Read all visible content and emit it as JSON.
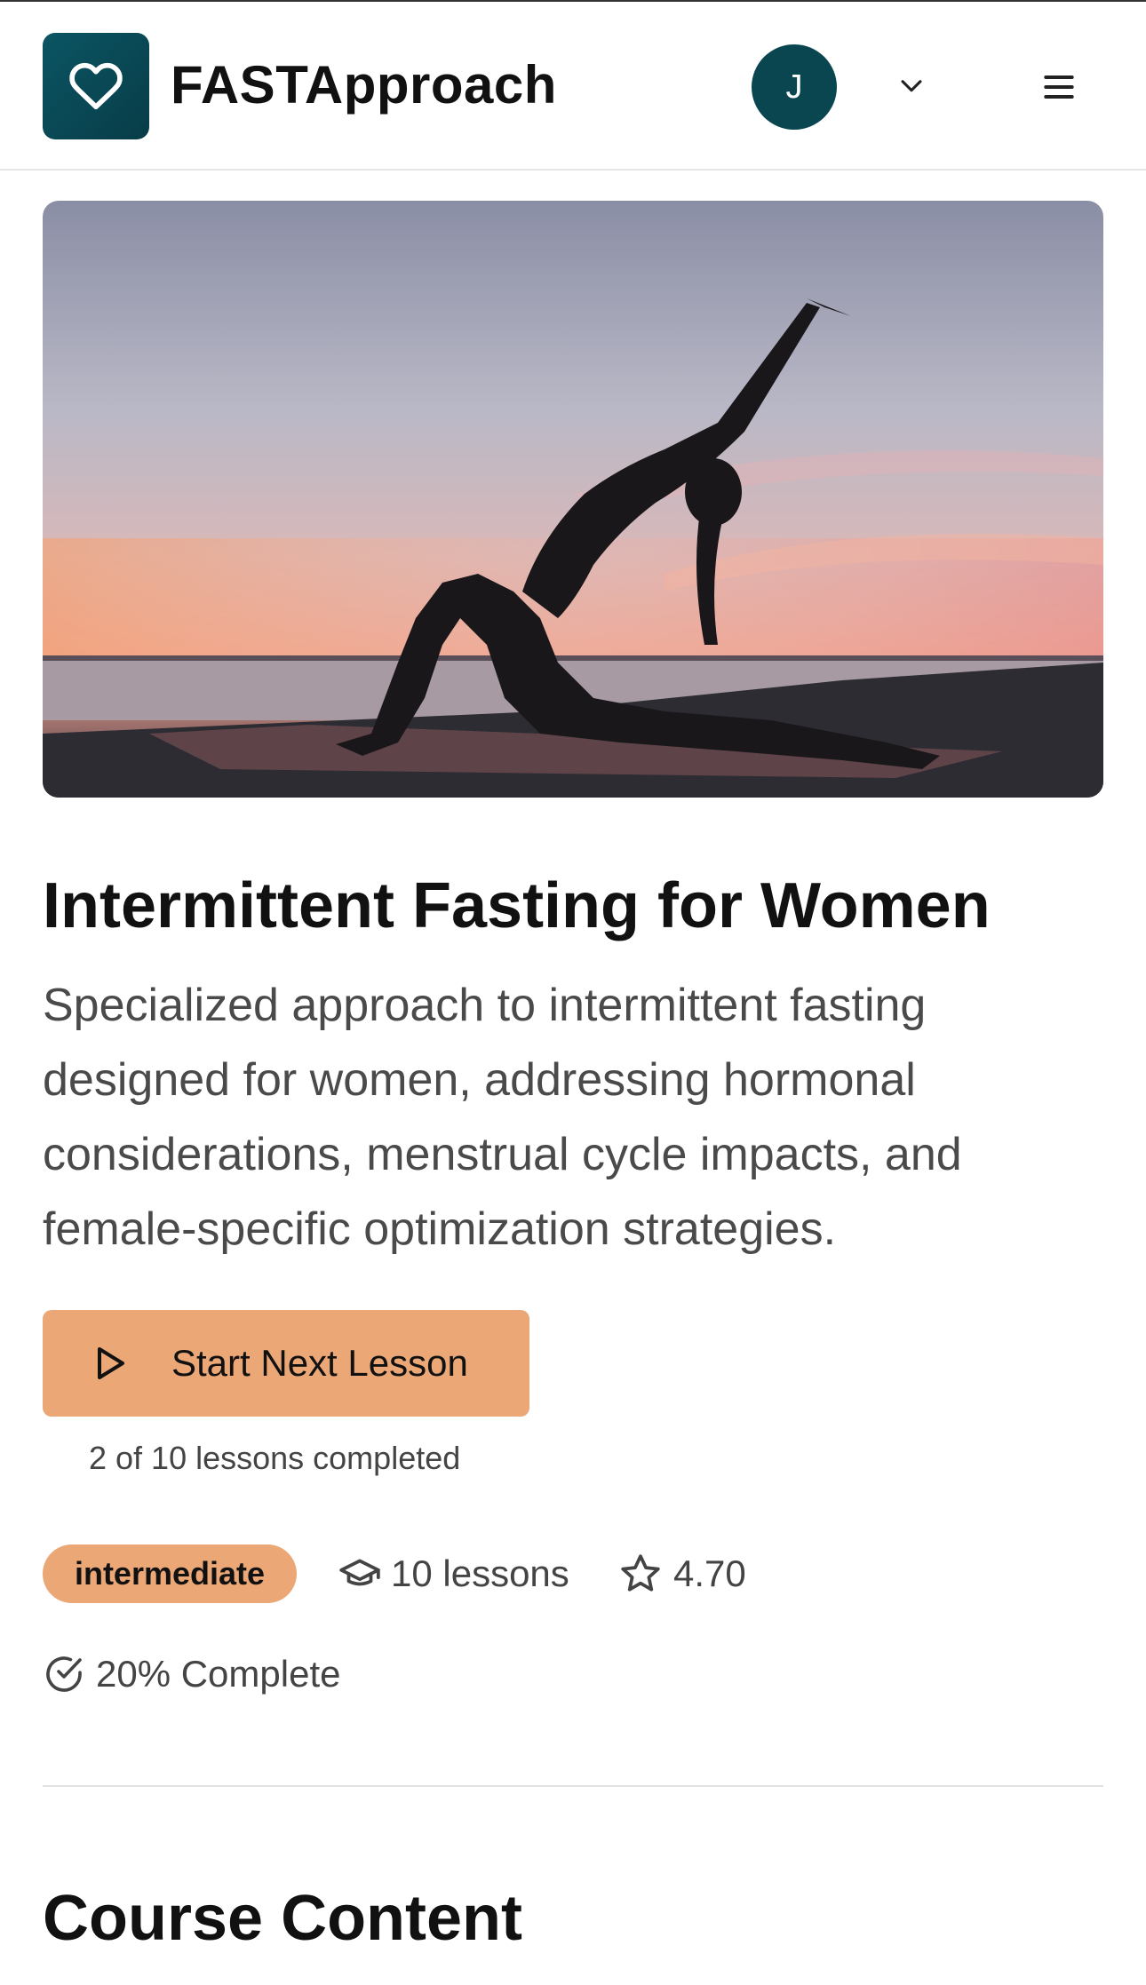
{
  "header": {
    "brand": "FASTApproach",
    "avatar_initial": "J",
    "logo_icon": "heart-icon",
    "account_chevron_icon": "chevron-down-icon",
    "menu_icon": "hamburger-menu-icon"
  },
  "course": {
    "hero_image_alt": "yoga silhouette at sunset",
    "title": "Intermittent Fasting for Women",
    "description": "Specialized approach to intermittent fasting designed for women, addressing hormonal considerations, menstrual cycle impacts, and female-specific optimization strategies.",
    "cta_label": "Start Next Lesson",
    "cta_icon": "play-icon",
    "progress_text": "2 of 10 lessons completed",
    "level": "intermediate",
    "lessons_label": "10 lessons",
    "lessons_icon": "graduation-cap-icon",
    "rating": "4.70",
    "rating_icon": "star-icon",
    "complete_label": "20% Complete",
    "complete_icon": "check-circle-icon",
    "completion_fraction": 0.2
  },
  "sections": {
    "course_content_title": "Course Content"
  },
  "colors": {
    "brand_teal": "#0a4650",
    "accent_orange": "#eba775",
    "text_dark": "#111111",
    "text_muted": "#4a4a4a"
  }
}
